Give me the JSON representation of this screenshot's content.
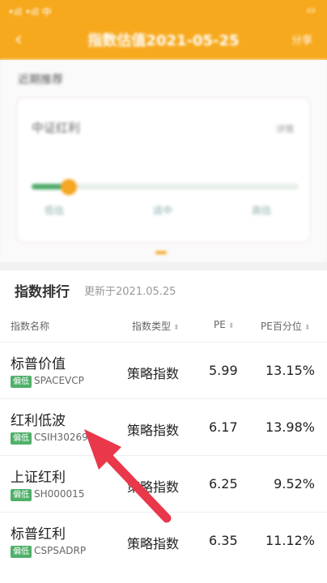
{
  "status": {
    "left": "•ıll •ıll 中",
    "time": "",
    "right": "▭"
  },
  "nav": {
    "title": "指数估值2021-05-25",
    "share": "分享"
  },
  "card": {
    "section_title": "近期推荐",
    "name": "中证红利",
    "tag": "详情",
    "level": 0.14,
    "levels": [
      "低估",
      "适中",
      "高估"
    ]
  },
  "ranking": {
    "title": "指数排行",
    "updated": "更新于2021.05.25",
    "columns": {
      "name": "指数名称",
      "type": "指数类型",
      "pe": "PE",
      "pct": "PE百分位",
      "sort": "⬍"
    },
    "rows": [
      {
        "name": "标普价值",
        "badge": "偏低",
        "code": "SPACEVCP",
        "type": "策略指数",
        "pe": "5.99",
        "pct": "13.15%"
      },
      {
        "name": "红利低波",
        "badge": "偏低",
        "code": "CSIH30269",
        "type": "策略指数",
        "pe": "6.17",
        "pct": "13.98%"
      },
      {
        "name": "上证红利",
        "badge": "偏低",
        "code": "SH000015",
        "type": "策略指数",
        "pe": "6.25",
        "pct": "9.52%"
      },
      {
        "name": "标普红利",
        "badge": "偏低",
        "code": "CSPSADRP",
        "type": "策略指数",
        "pe": "6.35",
        "pct": "11.12%"
      }
    ]
  },
  "colors": {
    "accent": "#f7a91d",
    "badge": "#50b06a",
    "arrow": "#e8384a"
  }
}
